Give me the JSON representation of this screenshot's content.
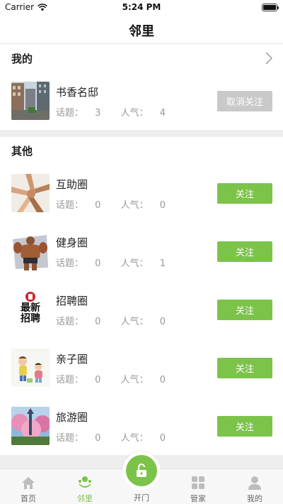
{
  "status": {
    "carrier": "Carrier",
    "time": "5:24 PM"
  },
  "nav": {
    "title": "邻里"
  },
  "mine": {
    "title": "我的",
    "items": [
      {
        "name": "书香名邸",
        "topics_label": "话题：",
        "topics": "3",
        "popularity_label": "人气：",
        "popularity": "4",
        "action": "取消关注"
      }
    ]
  },
  "others": {
    "title": "其他",
    "items": [
      {
        "name": "互助圈",
        "topics_label": "话题：",
        "topics": "0",
        "popularity_label": "人气：",
        "popularity": "0",
        "action": "关注"
      },
      {
        "name": "健身圈",
        "topics_label": "话题：",
        "topics": "0",
        "popularity_label": "人气：",
        "popularity": "1",
        "action": "关注"
      },
      {
        "name": "招聘圈",
        "topics_label": "话题：",
        "topics": "0",
        "popularity_label": "人气：",
        "popularity": "0",
        "action": "关注"
      },
      {
        "name": "亲子圈",
        "topics_label": "话题：",
        "topics": "0",
        "popularity_label": "人气：",
        "popularity": "0",
        "action": "关注"
      },
      {
        "name": "旅游圈",
        "topics_label": "话题：",
        "topics": "0",
        "popularity_label": "人气：",
        "popularity": "0",
        "action": "关注"
      }
    ]
  },
  "recruit_logo_text": [
    "最新",
    "招聘"
  ],
  "tabs": [
    {
      "label": "首页",
      "icon": "home-icon"
    },
    {
      "label": "邻里",
      "icon": "neighbor-icon"
    },
    {
      "label": "开门",
      "icon": "unlock-icon"
    },
    {
      "label": "管家",
      "icon": "grid-icon"
    },
    {
      "label": "我的",
      "icon": "person-icon"
    }
  ],
  "colors": {
    "accent": "#7cc34a",
    "unfollow": "#c9c9c9",
    "divider": "#eeeeee"
  }
}
